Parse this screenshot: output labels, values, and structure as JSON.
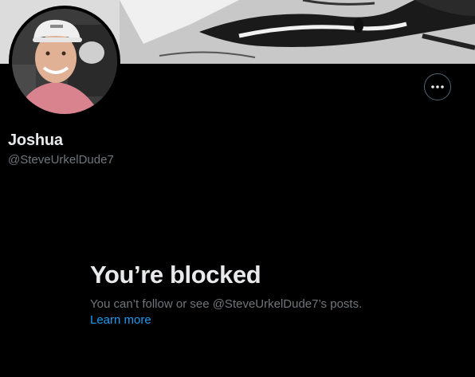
{
  "profile": {
    "display_name": "Joshua",
    "handle": "@SteveUrkelDude7"
  },
  "header": {
    "more_icon": "more-horizontal-icon"
  },
  "blocked": {
    "title": "You’re blocked",
    "message": "You can’t follow or see @SteveUrkelDude7’s posts.",
    "learn_more": "Learn more"
  },
  "colors": {
    "background": "#000000",
    "primary_text": "#e7e9ea",
    "secondary_text": "#71767b",
    "link": "#1d9bf0",
    "border": "#536471"
  }
}
